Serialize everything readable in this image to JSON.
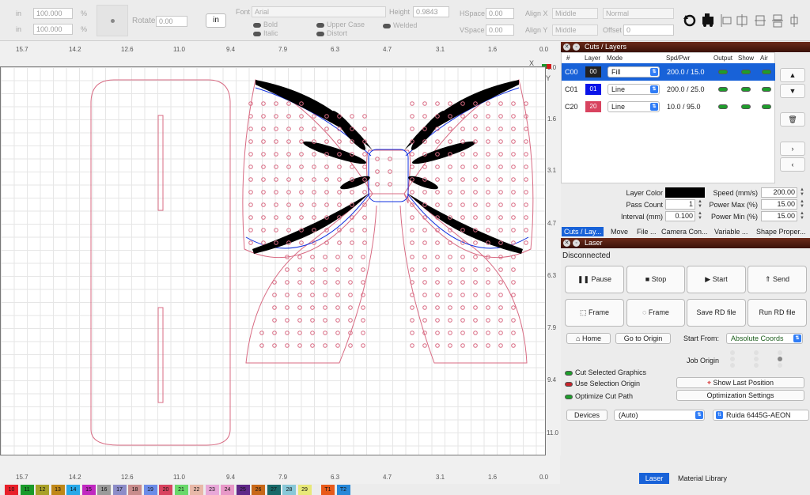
{
  "toolbar": {
    "unit1": "in",
    "unit2": "in",
    "scale_x": "100.000",
    "scale_y": "100.000",
    "percent": "%",
    "rotate_label": "Rotate",
    "rotate_value": "0.00",
    "units_button": "in",
    "font_label": "Font",
    "font_value": "Arial",
    "height_label": "Height",
    "height_value": "0.9843",
    "hspace_label": "HSpace",
    "hspace_value": "0.00",
    "vspace_label": "VSpace",
    "vspace_value": "0.00",
    "alignx_label": "Align X",
    "alignx_value": "Middle",
    "aligny_label": "Align Y",
    "aligny_value": "Middle",
    "normal_value": "Normal",
    "offset_label": "Offset",
    "offset_value": "0",
    "bold": "Bold",
    "italic": "Italic",
    "upper_case": "Upper Case",
    "distort": "Distort",
    "welded": "Welded"
  },
  "ruler": {
    "top_ticks": [
      "15.7",
      "14.2",
      "12.6",
      "11.0",
      "9.4",
      "7.9",
      "6.3",
      "4.7",
      "3.1",
      "1.6",
      "0.0"
    ],
    "side_ticks": [
      "0.0",
      "1.6",
      "3.1",
      "4.7",
      "6.3",
      "7.9",
      "9.4",
      "11.0"
    ],
    "x_label": "X",
    "y_label": "Y"
  },
  "cuts_panel": {
    "title": "Cuts / Layers",
    "headers": [
      "#",
      "Layer",
      "Mode",
      "Spd/Pwr",
      "Output",
      "Show",
      "Air"
    ],
    "rows": [
      {
        "id": "C00",
        "layer": "00",
        "mode": "Fill",
        "spd": "200.0 / 15.0",
        "color": "#222222"
      },
      {
        "id": "C01",
        "layer": "01",
        "mode": "Line",
        "spd": "200.0 / 25.0",
        "color": "#0a14e8"
      },
      {
        "id": "C20",
        "layer": "20",
        "mode": "Line",
        "spd": "10.0 / 95.0",
        "color": "#d8435f"
      }
    ],
    "layer_color_label": "Layer Color",
    "speed_label": "Speed (mm/s)",
    "speed_value": "200.00",
    "pass_label": "Pass Count",
    "pass_value": "1",
    "pmax_label": "Power Max (%)",
    "pmax_value": "15.00",
    "interval_label": "Interval (mm)",
    "interval_value": "0.100",
    "pmin_label": "Power Min (%)",
    "pmin_value": "15.00",
    "tabs": [
      "Cuts / Lay...",
      "Move",
      "File ...",
      "Camera Con...",
      "Variable ...",
      "Shape Proper..."
    ]
  },
  "laser_panel": {
    "title": "Laser",
    "status": "Disconnected",
    "pause": "Pause",
    "stop": "Stop",
    "start": "Start",
    "send": "Send",
    "frame1": "Frame",
    "frame2": "Frame",
    "save_rd": "Save RD file",
    "run_rd": "Run RD file",
    "home": "Home",
    "go_origin": "Go to Origin",
    "start_from_label": "Start From:",
    "start_from_value": "Absolute Coords",
    "job_origin_label": "Job Origin",
    "cut_selected": "Cut Selected Graphics",
    "use_selection": "Use Selection Origin",
    "optimize": "Optimize Cut Path",
    "show_last": "Show Last Position",
    "opt_settings": "Optimization Settings",
    "devices": "Devices",
    "port_value": "(Auto)",
    "device_value": "Ruida 6445G-AEON",
    "bottom_tabs": [
      "Laser",
      "Material Library"
    ]
  },
  "palette": [
    {
      "n": "10",
      "c": "#e8202a"
    },
    {
      "n": "11",
      "c": "#1a9a2a"
    },
    {
      "n": "12",
      "c": "#a8a028"
    },
    {
      "n": "13",
      "c": "#c08818"
    },
    {
      "n": "14",
      "c": "#28a8e8"
    },
    {
      "n": "15",
      "c": "#c028c0"
    },
    {
      "n": "16",
      "c": "#9a9a9a"
    },
    {
      "n": "17",
      "c": "#8c8cc8"
    },
    {
      "n": "18",
      "c": "#c88c8c"
    },
    {
      "n": "19",
      "c": "#6c8ce8"
    },
    {
      "n": "20",
      "c": "#d8435f"
    },
    {
      "n": "21",
      "c": "#6ad86a"
    },
    {
      "n": "22",
      "c": "#e8b8a8"
    },
    {
      "n": "23",
      "c": "#e8a8d8"
    },
    {
      "n": "24",
      "c": "#e898c8"
    },
    {
      "n": "25",
      "c": "#602888"
    },
    {
      "n": "26",
      "c": "#c86818"
    },
    {
      "n": "27",
      "c": "#186868"
    },
    {
      "n": "28",
      "c": "#88c8d8"
    },
    {
      "n": "29",
      "c": "#e8e878"
    },
    {
      "n": "T1",
      "c": "#e85a1a"
    },
    {
      "n": "T2",
      "c": "#2888d8"
    }
  ]
}
